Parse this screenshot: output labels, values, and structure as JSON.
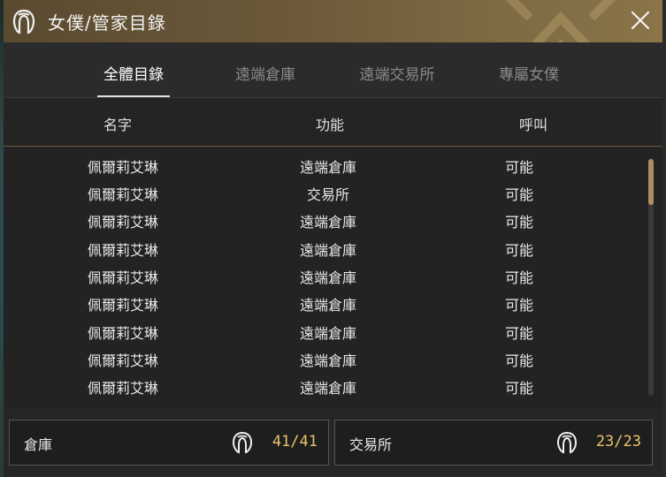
{
  "window": {
    "title": "女僕/管家目錄",
    "close_label": "×"
  },
  "tabs": [
    {
      "label": "全體目錄",
      "active": true
    },
    {
      "label": "遠端倉庫",
      "active": false
    },
    {
      "label": "遠端交易所",
      "active": false
    },
    {
      "label": "專屬女僕",
      "active": false
    }
  ],
  "columns": {
    "name": "名字",
    "function": "功能",
    "call": "呼叫"
  },
  "rows": [
    {
      "name": "佩爾莉艾琳",
      "function": "遠端倉庫",
      "call": "可能"
    },
    {
      "name": "佩爾莉艾琳",
      "function": "交易所",
      "call": "可能"
    },
    {
      "name": "佩爾莉艾琳",
      "function": "遠端倉庫",
      "call": "可能"
    },
    {
      "name": "佩爾莉艾琳",
      "function": "遠端倉庫",
      "call": "可能"
    },
    {
      "name": "佩爾莉艾琳",
      "function": "遠端倉庫",
      "call": "可能"
    },
    {
      "name": "佩爾莉艾琳",
      "function": "遠端倉庫",
      "call": "可能"
    },
    {
      "name": "佩爾莉艾琳",
      "function": "遠端倉庫",
      "call": "可能"
    },
    {
      "name": "佩爾莉艾琳",
      "function": "遠端倉庫",
      "call": "可能"
    },
    {
      "name": "佩爾莉艾琳",
      "function": "遠端倉庫",
      "call": "可能"
    }
  ],
  "summary": {
    "warehouse": {
      "label": "倉庫",
      "count": "41/41"
    },
    "market": {
      "label": "交易所",
      "count": "23/23"
    }
  },
  "icons": {
    "title": "maid-icon",
    "warehouse": "maid-icon",
    "market": "maid-icon"
  },
  "colors": {
    "accent": "#e9c36a",
    "title_bar": "#6c5a3a",
    "scroll_thumb": "#b08c64"
  }
}
